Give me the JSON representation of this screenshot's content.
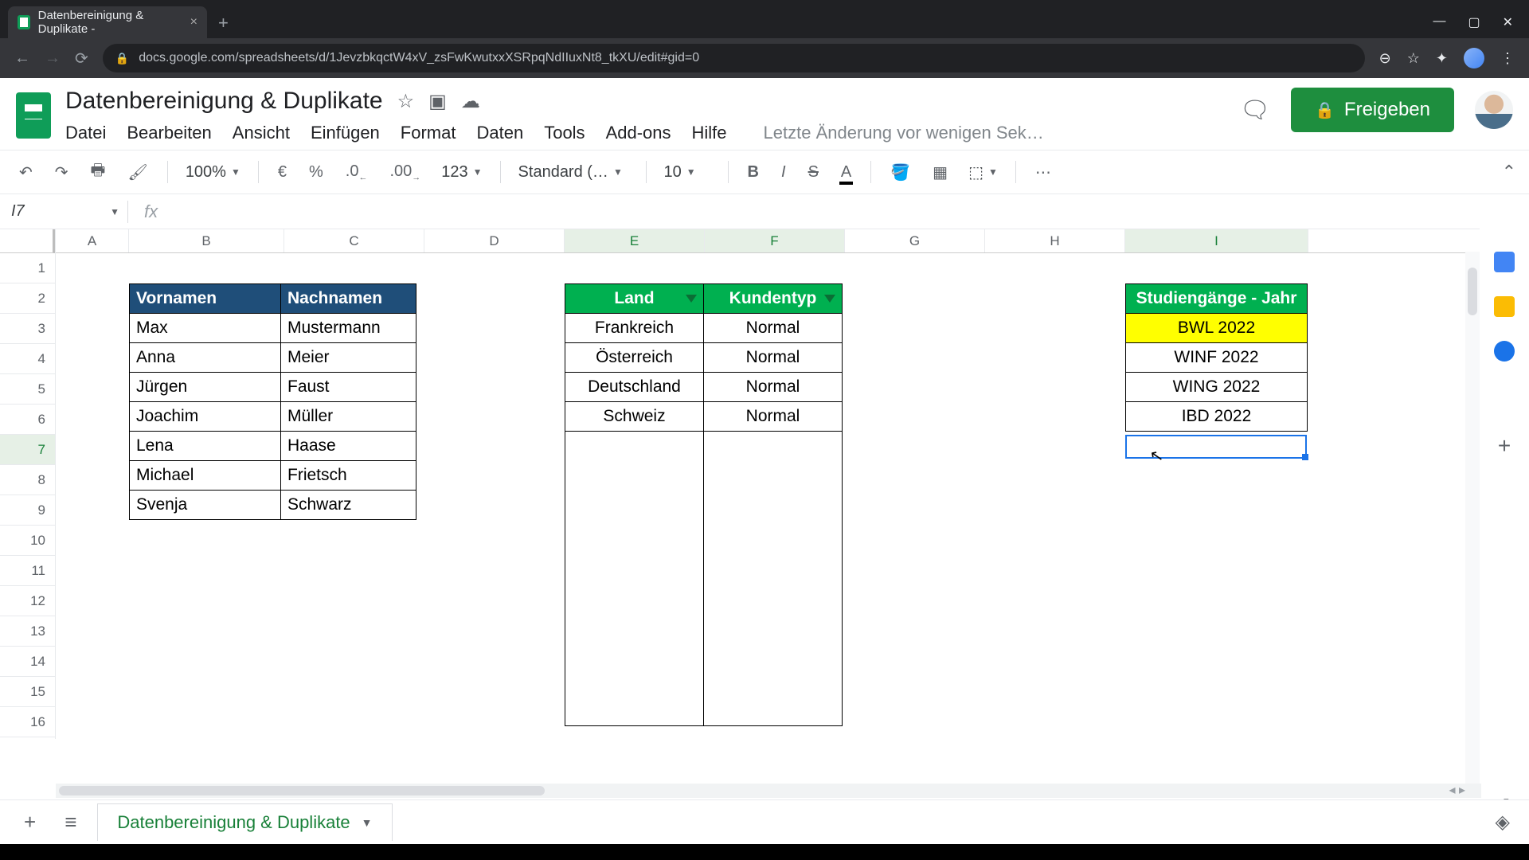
{
  "browser": {
    "tab_title": "Datenbereinigung & Duplikate -",
    "url": "docs.google.com/spreadsheets/d/1JevzbkqctW4xV_zsFwKwutxxXSRpqNdIIuxNt8_tkXU/edit#gid=0"
  },
  "header": {
    "doc_title": "Datenbereinigung & Duplikate",
    "last_edit": "Letzte Änderung vor wenigen Sek…",
    "share_label": "Freigeben"
  },
  "menus": {
    "file": "Datei",
    "edit": "Bearbeiten",
    "view": "Ansicht",
    "insert": "Einfügen",
    "format": "Format",
    "data": "Daten",
    "tools": "Tools",
    "addons": "Add-ons",
    "help": "Hilfe"
  },
  "toolbar": {
    "zoom": "100%",
    "currency": "€",
    "percent": "%",
    "dec_less": ".0",
    "dec_more": ".00",
    "numfmt": "123",
    "font": "Standard (…",
    "fontsize": "10"
  },
  "namebox": {
    "ref": "I7"
  },
  "columns": [
    "A",
    "B",
    "C",
    "D",
    "E",
    "F",
    "G",
    "H",
    "I"
  ],
  "rows": [
    "1",
    "2",
    "3",
    "4",
    "5",
    "6",
    "7",
    "8",
    "9",
    "10",
    "11",
    "12",
    "13",
    "14",
    "15",
    "16"
  ],
  "table1": {
    "h1": "Vornamen",
    "h2": "Nachnamen",
    "rows": [
      [
        "Max",
        "Mustermann"
      ],
      [
        "Anna",
        "Meier"
      ],
      [
        "Jürgen",
        "Faust"
      ],
      [
        "Joachim",
        "Müller"
      ],
      [
        "Lena",
        "Haase"
      ],
      [
        "Michael",
        "Frietsch"
      ],
      [
        "Svenja",
        "Schwarz"
      ]
    ]
  },
  "table2": {
    "h1": "Land",
    "h2": "Kundentyp",
    "rows": [
      [
        "Frankreich",
        "Normal"
      ],
      [
        "Österreich",
        "Normal"
      ],
      [
        "Deutschland",
        "Normal"
      ],
      [
        "Schweiz",
        "Normal"
      ]
    ]
  },
  "table3": {
    "h1": "Studiengänge - Jahr",
    "rows": [
      "BWL 2022",
      "WINF 2022",
      "WING 2022",
      "IBD 2022"
    ]
  },
  "sheet_tab": {
    "name": "Datenbereinigung & Duplikate"
  }
}
